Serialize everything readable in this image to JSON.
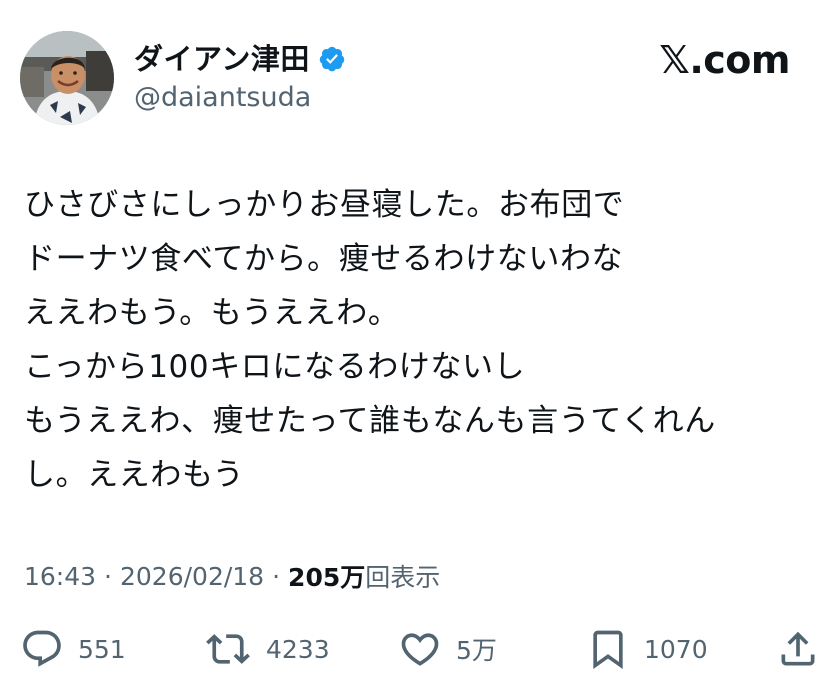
{
  "author": {
    "display_name": "ダイアン津田",
    "handle": "@daiantsuda",
    "verified_icon": "verified-badge-icon",
    "verified_color": "#1d9bf0"
  },
  "site_label": "𝕏.com",
  "tweet": {
    "lines": [
      "ひさびさにしっかりお昼寝した。お布団で",
      "ドーナツ食べてから。痩せるわけないわな",
      "ええわもう。もうええわ。",
      "こっから100キロになるわけないし",
      "もうええわ、痩せたって誰もなんも言うてくれん",
      "し。ええわもう"
    ]
  },
  "meta": {
    "time": "16:43",
    "separator": "·",
    "date": "2026/02/18",
    "views_count": "205万",
    "views_label": "回表示"
  },
  "actions": {
    "replies": {
      "icon": "reply-icon",
      "count": "551"
    },
    "reposts": {
      "icon": "repost-icon",
      "count": "4233"
    },
    "likes": {
      "icon": "heart-icon",
      "count": "5万"
    },
    "bookmarks": {
      "icon": "bookmark-icon",
      "count": "1070"
    },
    "share": {
      "icon": "share-icon"
    }
  },
  "colors": {
    "text": "#0f1419",
    "secondary": "#536471",
    "accent": "#1d9bf0"
  }
}
